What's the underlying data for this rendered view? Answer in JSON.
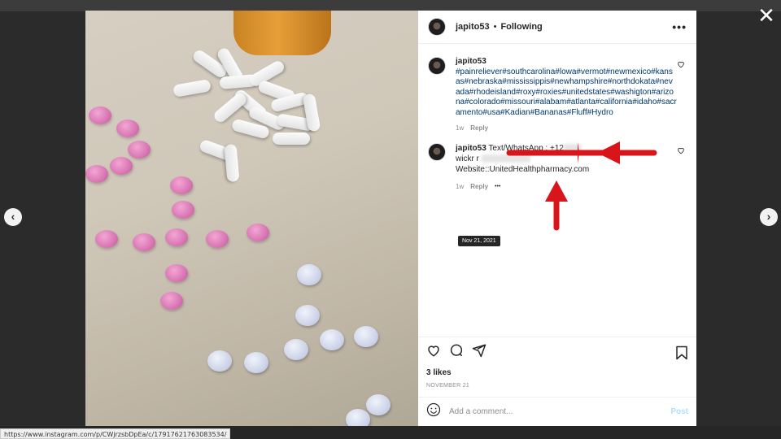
{
  "viewer": {
    "close_icon": "close-icon",
    "prev_icon": "chevron-left-icon",
    "next_icon": "chevron-right-icon",
    "close_glyph": "✕",
    "prev_glyph": "‹",
    "next_glyph": "›"
  },
  "header": {
    "username": "japito53",
    "separator": "•",
    "follow_status": "Following",
    "more_icon": "ellipsis-icon",
    "more_glyph": "•••"
  },
  "comments": [
    {
      "username": "japito53",
      "text": "#painreliever#southcarolina#lowa#vermot#newmexico#kansas#nebraska#mississippis#newhampshire#northdokata#nevada#rhodeisland#roxy#roxies#unitedstates#washigton#arizona#colorado#missouri#alabam#atlanta#california#idaho#sacramento#usa#Kadian#Bananas#Fluff#Hydro",
      "age": "1w",
      "reply_label": "Reply"
    },
    {
      "username": "japito53",
      "line1": "Text/WhatsApp : +1",
      "line1_suffix": "2",
      "line2": "wickr r",
      "line3": "Website::UnitedHealthpharmacy.com",
      "age": "1w",
      "reply_label": "Reply",
      "more_glyph": "•••",
      "tooltip": "Nov 21, 2021"
    }
  ],
  "actions": {
    "likes": "3 likes",
    "date": "NOVEMBER 21",
    "icons": [
      "heart-icon",
      "comment-icon",
      "share-icon",
      "bookmark-icon"
    ]
  },
  "composer": {
    "placeholder": "Add a comment...",
    "post_label": "Post",
    "emoji_icon": "emoji-icon"
  },
  "status_bar": {
    "url": "https://www.instagram.com/p/CWjrzsbDpEa/c/17917621763083534/"
  },
  "colors": {
    "annotation_arrow": "#d9141b",
    "hashtag": "#00376b",
    "post_button_disabled": "#b2dffc",
    "secondary_text": "#8e8e8e"
  }
}
